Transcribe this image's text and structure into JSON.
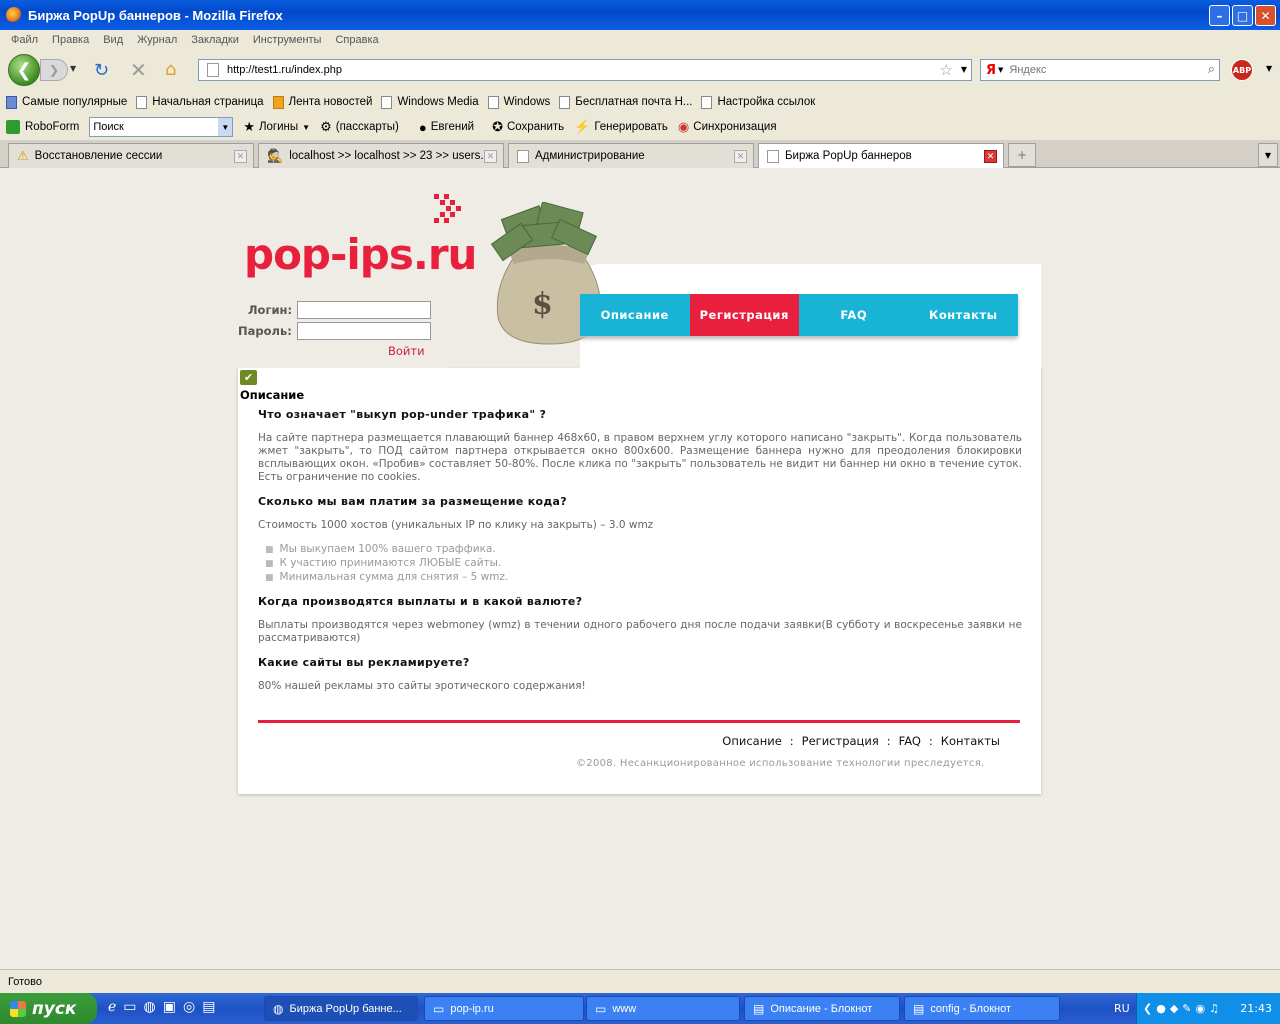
{
  "window": {
    "title": "Биржа PopUp баннеров - Mozilla Firefox"
  },
  "menu": [
    "Файл",
    "Правка",
    "Вид",
    "Журнал",
    "Закладки",
    "Инструменты",
    "Справка"
  ],
  "nav": {
    "url": "http://test1.ru/index.php",
    "search_placeholder": "Яндекс",
    "search_engine": "Я",
    "adblock_label": "ABP"
  },
  "bookmarks": [
    {
      "label": "Самые популярные",
      "icon": "popular"
    },
    {
      "label": "Начальная страница",
      "icon": "page"
    },
    {
      "label": "Лента новостей",
      "icon": "rss"
    },
    {
      "label": "Windows Media",
      "icon": "page"
    },
    {
      "label": "Windows",
      "icon": "page"
    },
    {
      "label": "Бесплатная почта H...",
      "icon": "page"
    },
    {
      "label": "Настройка ссылок",
      "icon": "page"
    }
  ],
  "roboform": {
    "brand": "RoboForm",
    "search_value": "Поиск",
    "items": [
      "Логины",
      "(пасскарты)",
      "Евгений",
      "Сохранить",
      "Генерировать",
      "Синхронизация"
    ]
  },
  "tabs": [
    {
      "label": "Восстановление сессии"
    },
    {
      "label": "localhost >> localhost >> 23 >> users..."
    },
    {
      "label": "Администрирование"
    },
    {
      "label": "Биржа PopUp баннеров"
    }
  ],
  "page": {
    "logo": "pop-ips.ru",
    "nav": [
      "Описание",
      "Регистрация",
      "FAQ",
      "Контакты"
    ],
    "login": {
      "login_label": "Логин:",
      "password_label": "Пароль:",
      "submit": "Войти"
    },
    "section_title": "Описание",
    "article": {
      "q1": "Что означает \"выкуп pop-under трафика\" ?",
      "a1": "На сайте партнера размещается плавающий баннер 468x60, в правом верхнем углу которого написано \"закрыть\". Когда пользователь жмет \"закрыть\", то ПОД сайтом партнера открывается окно 800x600. Размещение баннера нужно для преодоления блокировки всплывающих окон. «Пробив» составляет 50-80%. После клика по \"закрыть\" пользователь не видит ни баннер ни окно в течение суток. Есть ограничение по cookies.",
      "q2": "Сколько мы вам платим за размещение кода?",
      "a2": "Стоимость 1000 хостов (уникальных IP по клику на закрыть) – 3.0 wmz",
      "list": [
        "Мы выкупаем 100% вашего траффика.",
        "К участию принимаются ЛЮБЫЕ сайты.",
        "Минимальная сумма для снятия – 5 wmz."
      ],
      "q3": "Когда производятся выплаты и в какой валюте?",
      "a3": "Выплаты производятся через webmoney (wmz) в течении одного рабочего дня после подачи заявки(В субботу и воскресенье заявки не рассматриваются)",
      "q4": "Какие сайты вы рекламируете?",
      "a4": "80% нашей рекламы это сайты эротического содержания!"
    },
    "footer_nav": [
      "Описание",
      ":",
      "Регистрация",
      ":",
      "FAQ",
      ":",
      "Контакты"
    ],
    "copyright": "©2008. Несанкционированное использование технологии преследуется."
  },
  "status": "Готово",
  "taskbar": {
    "start": "пуск",
    "tasks": [
      "Биржа PopUp банне...",
      "pop-ip.ru",
      "www",
      "Описание - Блокнот",
      "config - Блокнот"
    ],
    "lang": "RU",
    "clock": "21:43"
  },
  "colors": {
    "brand_red": "#e8203e",
    "nav_blue": "#19b4d5"
  }
}
